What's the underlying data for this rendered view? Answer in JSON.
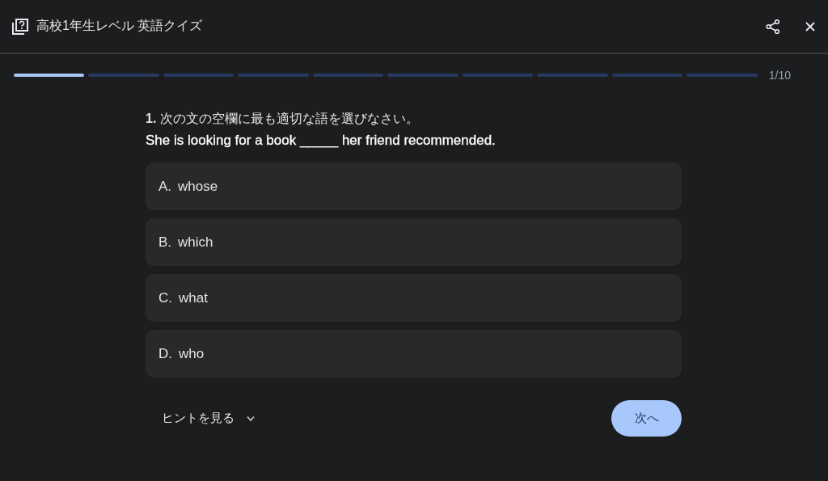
{
  "header": {
    "title": "高校1年生レベル 英語クイズ"
  },
  "progress": {
    "segments": [
      {
        "done": true
      },
      {
        "done": false
      },
      {
        "done": false
      },
      {
        "done": false
      },
      {
        "done": false
      },
      {
        "done": false
      },
      {
        "done": false
      },
      {
        "done": false
      },
      {
        "done": false
      },
      {
        "done": false
      }
    ],
    "counter": "1/10"
  },
  "question": {
    "prompt": "**1.** 次の文の空欄に最も適切な語を選びなさい。",
    "sentence": "She is looking for a book _____ her friend recommended."
  },
  "options": [
    {
      "letter": "A.",
      "text": "whose",
      "selected": false
    },
    {
      "letter": "B.",
      "text": "which",
      "selected": false
    },
    {
      "letter": "C.",
      "text": "what",
      "selected": false
    },
    {
      "letter": "D.",
      "text": "who",
      "selected": false
    }
  ],
  "hint": {
    "label": "ヒントを見る",
    "expanded": false
  },
  "next_button": "次へ"
}
